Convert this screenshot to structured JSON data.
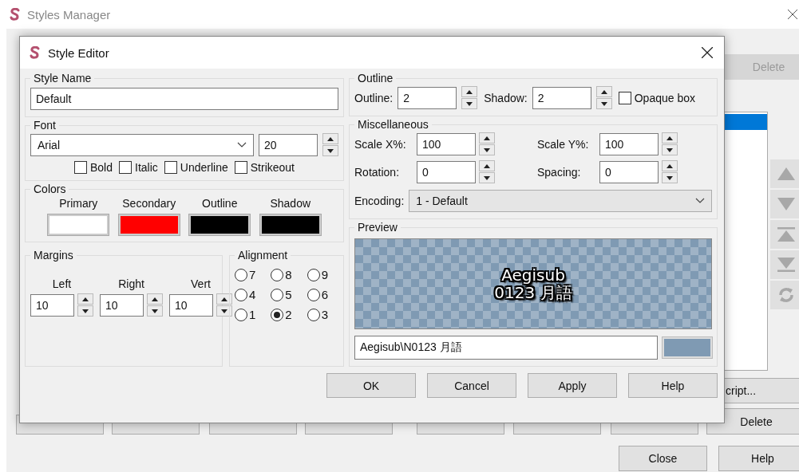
{
  "manager": {
    "title": "Styles Manager",
    "top_button": {
      "label": "Delete",
      "disabled": true
    },
    "list_rows": [
      {
        "selected": true
      }
    ],
    "side_button": {
      "label": "cript..."
    },
    "lower_button": {
      "label": "Delete",
      "disabled": false
    },
    "footer_buttons": [
      "Close",
      "Help"
    ]
  },
  "editor": {
    "title": "Style Editor",
    "style_name": {
      "label": "Style Name",
      "value": "Default"
    },
    "font": {
      "label": "Font",
      "family": "Arial",
      "size": "20",
      "options": [
        {
          "label": "Bold",
          "checked": false
        },
        {
          "label": "Italic",
          "checked": false
        },
        {
          "label": "Underline",
          "checked": false
        },
        {
          "label": "Strikeout",
          "checked": false
        }
      ]
    },
    "colors": {
      "label": "Colors",
      "swatches": [
        {
          "label": "Primary",
          "color": "#ffffff"
        },
        {
          "label": "Secondary",
          "color": "#ff0000"
        },
        {
          "label": "Outline",
          "color": "#000000"
        },
        {
          "label": "Shadow",
          "color": "#000000"
        }
      ]
    },
    "margins": {
      "label": "Margins",
      "fields": [
        {
          "label": "Left",
          "value": "10"
        },
        {
          "label": "Right",
          "value": "10"
        },
        {
          "label": "Vert",
          "value": "10"
        }
      ]
    },
    "alignment": {
      "label": "Alignment",
      "options": [
        {
          "label": "7",
          "selected": false
        },
        {
          "label": "8",
          "selected": false
        },
        {
          "label": "9",
          "selected": false
        },
        {
          "label": "4",
          "selected": false
        },
        {
          "label": "5",
          "selected": false
        },
        {
          "label": "6",
          "selected": false
        },
        {
          "label": "1",
          "selected": false
        },
        {
          "label": "2",
          "selected": true
        },
        {
          "label": "3",
          "selected": false
        }
      ]
    },
    "outline": {
      "label": "Outline",
      "outline_field": {
        "label": "Outline:",
        "value": "2"
      },
      "shadow_field": {
        "label": "Shadow:",
        "value": "2"
      },
      "opaque_box": {
        "label": "Opaque box",
        "checked": false
      }
    },
    "misc": {
      "label": "Miscellaneous",
      "fields": [
        {
          "label": "Scale X%:",
          "value": "100"
        },
        {
          "label": "Scale Y%:",
          "value": "100"
        },
        {
          "label": "Rotation:",
          "value": "0"
        },
        {
          "label": "Spacing:",
          "value": "0"
        }
      ],
      "encoding": {
        "label": "Encoding:",
        "value": "1 - Default"
      }
    },
    "preview": {
      "label": "Preview",
      "lines": [
        "Aegisub",
        "0123 月語"
      ],
      "text": "Aegisub\\N0123 月語",
      "color": "#7f9ab3"
    },
    "buttons": [
      "OK",
      "Cancel",
      "Apply",
      "Help"
    ]
  }
}
